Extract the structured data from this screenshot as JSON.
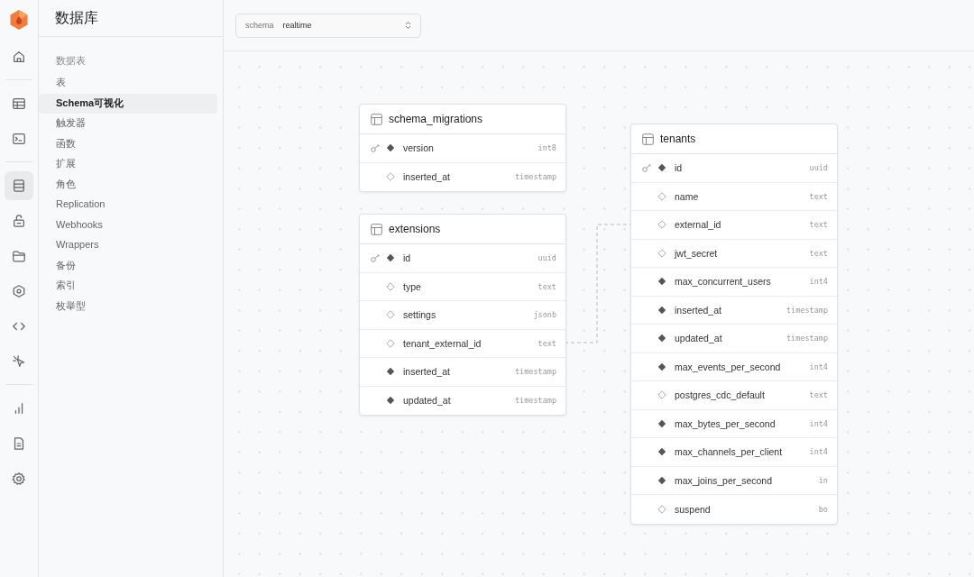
{
  "rail": [
    {
      "selected": false
    },
    {
      "selected": false
    },
    {
      "selected": false
    },
    {
      "selected": true
    },
    {
      "selected": false
    },
    {
      "selected": false
    },
    {
      "selected": false
    },
    {
      "selected": false
    },
    {
      "selected": false
    },
    {
      "selected": false
    },
    {
      "selected": false
    },
    {
      "selected": false
    }
  ],
  "sidebar": {
    "title": "数据库",
    "section": "数据表",
    "items": [
      {
        "label": "表",
        "selected": false
      },
      {
        "label": "Schema可视化",
        "selected": true
      },
      {
        "label": "触发器",
        "selected": false
      },
      {
        "label": "函数",
        "selected": false
      },
      {
        "label": "扩展",
        "selected": false
      },
      {
        "label": "角色",
        "selected": false
      },
      {
        "label": "Replication",
        "selected": false
      },
      {
        "label": "Webhooks",
        "selected": false
      },
      {
        "label": "Wrappers",
        "selected": false
      },
      {
        "label": "备份",
        "selected": false
      },
      {
        "label": "索引",
        "selected": false
      },
      {
        "label": "枚举型",
        "selected": false
      }
    ]
  },
  "schema_select": {
    "label": "schema",
    "value": "realtime"
  },
  "tables": [
    {
      "name": "schema_migrations",
      "columns": [
        {
          "name": "version",
          "type": "int8",
          "primary_key": true,
          "nullable": false
        },
        {
          "name": "inserted_at",
          "type": "timestamp",
          "primary_key": false,
          "nullable": true
        }
      ]
    },
    {
      "name": "extensions",
      "columns": [
        {
          "name": "id",
          "type": "uuid",
          "primary_key": true,
          "nullable": false
        },
        {
          "name": "type",
          "type": "text",
          "primary_key": false,
          "nullable": true
        },
        {
          "name": "settings",
          "type": "jsonb",
          "primary_key": false,
          "nullable": true
        },
        {
          "name": "tenant_external_id",
          "type": "text",
          "primary_key": false,
          "nullable": true
        },
        {
          "name": "inserted_at",
          "type": "timestamp",
          "primary_key": false,
          "nullable": false
        },
        {
          "name": "updated_at",
          "type": "timestamp",
          "primary_key": false,
          "nullable": false
        }
      ]
    },
    {
      "name": "tenants",
      "columns": [
        {
          "name": "id",
          "type": "uuid",
          "primary_key": true,
          "nullable": false
        },
        {
          "name": "name",
          "type": "text",
          "primary_key": false,
          "nullable": true
        },
        {
          "name": "external_id",
          "type": "text",
          "primary_key": false,
          "nullable": true
        },
        {
          "name": "jwt_secret",
          "type": "text",
          "primary_key": false,
          "nullable": true
        },
        {
          "name": "max_concurrent_users",
          "type": "int4",
          "primary_key": false,
          "nullable": false
        },
        {
          "name": "inserted_at",
          "type": "timestamp",
          "primary_key": false,
          "nullable": false
        },
        {
          "name": "updated_at",
          "type": "timestamp",
          "primary_key": false,
          "nullable": false
        },
        {
          "name": "max_events_per_second",
          "type": "int4",
          "primary_key": false,
          "nullable": false
        },
        {
          "name": "postgres_cdc_default",
          "type": "text",
          "primary_key": false,
          "nullable": true
        },
        {
          "name": "max_bytes_per_second",
          "type": "int4",
          "primary_key": false,
          "nullable": false
        },
        {
          "name": "max_channels_per_client",
          "type": "int4",
          "primary_key": false,
          "nullable": false
        },
        {
          "name": "max_joins_per_second",
          "type": "in",
          "primary_key": false,
          "nullable": false
        },
        {
          "name": "suspend",
          "type": "bo",
          "primary_key": false,
          "nullable": true
        }
      ]
    }
  ]
}
